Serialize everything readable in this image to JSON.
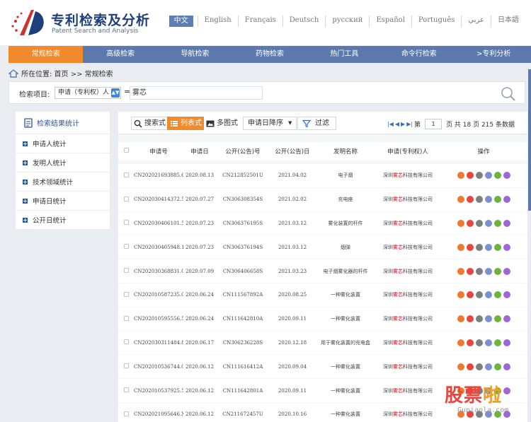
{
  "header": {
    "title": "专利检索及分析",
    "subtitle": "Patent Search and Analysis"
  },
  "languages": [
    "中文",
    "English",
    "Français",
    "Deutsch",
    "русский",
    "Español",
    "Português",
    "عربي",
    "日本語"
  ],
  "nav": [
    "常规检索",
    "高级检索",
    "导航检索",
    "药物检索",
    "热门工具",
    "命令行检索",
    ">专利分析"
  ],
  "breadcrumb": "所在位置: 首页 >> 常规检索",
  "search": {
    "label": "检索项目:",
    "field": "申请（专利权）人",
    "equals": "=",
    "value": "雾芯"
  },
  "stats": {
    "title": "检索结果统计",
    "items": [
      "申请人统计",
      "发明人统计",
      "技术领域统计",
      "申请日统计",
      "公开日统计"
    ]
  },
  "toolbar": {
    "search_mode": "搜索式",
    "list_mode": "列表式",
    "image_mode": "多图式",
    "sort": "申请日降序",
    "filter": "过滤"
  },
  "pager": {
    "prefix": "第",
    "page": "1",
    "suffix": "页 共 18 页 215 条数据"
  },
  "columns": [
    "申请号",
    "申请日",
    "公开(公告)号",
    "公开(公告)日",
    "发明名称",
    "申请(专利权)人",
    "操作"
  ],
  "rows": [
    {
      "app_no": "CN202021693885.6",
      "app_date": "2020.08.13",
      "pub_no": "CN212852501U",
      "pub_date": "2021.04.02",
      "title": "电子烟",
      "applicant_pre": "深圳",
      "applicant_hl": "雾芯",
      "applicant_post": "科技有限公司"
    },
    {
      "app_no": "CN202030414372.5",
      "app_date": "2020.07.27",
      "pub_no": "CN306308354S",
      "pub_date": "2021.02.02",
      "title": "充电座",
      "applicant_pre": "深圳",
      "applicant_hl": "雾芯",
      "applicant_post": "科技有限公司"
    },
    {
      "app_no": "CN202030406101.5",
      "app_date": "2020.07.23",
      "pub_no": "CN306376195S",
      "pub_date": "2021.03.12",
      "title": "雾化装置的杆件",
      "applicant_pre": "深圳",
      "applicant_hl": "雾芯",
      "applicant_post": "科技有限公司"
    },
    {
      "app_no": "CN202030405948.1",
      "app_date": "2020.07.23",
      "pub_no": "CN306376194S",
      "pub_date": "2021.03.12",
      "title": "烟弹",
      "applicant_pre": "深圳",
      "applicant_hl": "雾芯",
      "applicant_post": "科技有限公司"
    },
    {
      "app_no": "CN202030368831.0",
      "app_date": "2020.07.09",
      "pub_no": "CN306406658S",
      "pub_date": "2021.03.23",
      "title": "电子烟雾化器的杆件",
      "applicant_pre": "深圳",
      "applicant_hl": "雾芯",
      "applicant_post": "科技有限公司"
    },
    {
      "app_no": "CN202010587235.0",
      "app_date": "2020.06.24",
      "pub_no": "CN111567892A",
      "pub_date": "2020.08.25",
      "title": "一种雾化装置",
      "applicant_pre": "深圳",
      "applicant_hl": "雾芯",
      "applicant_post": "科技有限公司"
    },
    {
      "app_no": "CN202010595556.5",
      "app_date": "2020.06.24",
      "pub_no": "CN111642810A",
      "pub_date": "2020.09.11",
      "title": "一种雾化装置",
      "applicant_pre": "深圳",
      "applicant_hl": "雾芯",
      "applicant_post": "科技有限公司"
    },
    {
      "app_no": "CN202030311484.8",
      "app_date": "2020.06.17",
      "pub_no": "CN306236228S",
      "pub_date": "2020.12.18",
      "title": "用于雾化装置的充电盒",
      "applicant_pre": "深圳",
      "applicant_hl": "雾芯",
      "applicant_post": "科技有限公司"
    },
    {
      "app_no": "CN202010536744.0",
      "app_date": "2020.06.12",
      "pub_no": "CN111616412A",
      "pub_date": "2020.09.04",
      "title": "一种雾化装置",
      "applicant_pre": "深圳",
      "applicant_hl": "雾芯",
      "applicant_post": "科技有限公司"
    },
    {
      "app_no": "CN202010537925.5",
      "app_date": "2020.06.12",
      "pub_no": "CN111642801A",
      "pub_date": "2020.09.11",
      "title": "一种雾化装置",
      "applicant_pre": "深圳",
      "applicant_hl": "雾芯",
      "applicant_post": "科技有限公司"
    },
    {
      "app_no": "CN202021095646.X",
      "app_date": "2020.06.12",
      "pub_no": "CN211672457U",
      "pub_date": "2020.10.16",
      "title": "一种雾化装置",
      "applicant_pre": "深圳",
      "applicant_hl": "雾芯",
      "applicant_post": "科技有限公司"
    }
  ],
  "op_icons": [
    {
      "name": "detail-icon",
      "color": "#f0782f"
    },
    {
      "name": "favorite-icon",
      "color": "#e8453c"
    },
    {
      "name": "add-icon",
      "color": "#7a7f86"
    },
    {
      "name": "analysis-icon",
      "color": "#7b8fd6"
    },
    {
      "name": "share-icon",
      "color": "#6db33f"
    },
    {
      "name": "trend-icon",
      "color": "#a066d8"
    }
  ],
  "watermark": {
    "text": "股票啦",
    "sub": "Gupiaola.com"
  },
  "colors": {
    "nav": "#5b79ad",
    "accent": "#f08a2c",
    "brand": "#1f3e7c",
    "highlight": "#d0021b"
  }
}
